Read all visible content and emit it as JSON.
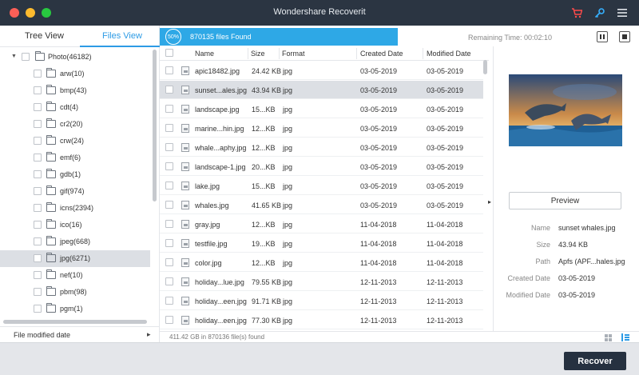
{
  "window": {
    "title": "Wondershare Recoverit"
  },
  "toolbar": {
    "cart_icon": "cart-icon",
    "key_icon": "key-icon",
    "menu_icon": "menu-icon"
  },
  "sidebar": {
    "tabs": [
      {
        "label": "Tree View",
        "active": false
      },
      {
        "label": "Files View",
        "active": true
      }
    ],
    "root": {
      "label": "Photo(46182)"
    },
    "items": [
      {
        "label": "arw(10)"
      },
      {
        "label": "bmp(43)"
      },
      {
        "label": "cdt(4)"
      },
      {
        "label": "cr2(20)"
      },
      {
        "label": "crw(24)"
      },
      {
        "label": "emf(6)"
      },
      {
        "label": "gdb(1)"
      },
      {
        "label": "gif(974)"
      },
      {
        "label": "icns(2394)"
      },
      {
        "label": "ico(16)"
      },
      {
        "label": "jpeg(668)"
      },
      {
        "label": "jpg(6271)",
        "selected": true
      },
      {
        "label": "nef(10)"
      },
      {
        "label": "pbm(98)"
      },
      {
        "label": "pgm(1)"
      }
    ],
    "filter_label": "File modified date"
  },
  "scan": {
    "percent": "50%",
    "percent_value": 50,
    "found_text": "870135 files Found",
    "remaining_time": "Remaining Time: 00:02:10"
  },
  "table": {
    "columns": [
      "Name",
      "Size",
      "Format",
      "Created Date",
      "Modified Date"
    ],
    "rows": [
      {
        "name": "apic18482.jpg",
        "size": "24.42 KB",
        "format": "jpg",
        "created": "03-05-2019",
        "modified": "03-05-2019"
      },
      {
        "name": "sunset...ales.jpg",
        "size": "43.94 KB",
        "format": "jpg",
        "created": "03-05-2019",
        "modified": "03-05-2019",
        "selected": true
      },
      {
        "name": "landscape.jpg",
        "size": "15...KB",
        "format": "jpg",
        "created": "03-05-2019",
        "modified": "03-05-2019"
      },
      {
        "name": "marine...hin.jpg",
        "size": "12...KB",
        "format": "jpg",
        "created": "03-05-2019",
        "modified": "03-05-2019"
      },
      {
        "name": "whale...aphy.jpg",
        "size": "12...KB",
        "format": "jpg",
        "created": "03-05-2019",
        "modified": "03-05-2019"
      },
      {
        "name": "landscape-1.jpg",
        "size": "20...KB",
        "format": "jpg",
        "created": "03-05-2019",
        "modified": "03-05-2019"
      },
      {
        "name": "lake.jpg",
        "size": "15...KB",
        "format": "jpg",
        "created": "03-05-2019",
        "modified": "03-05-2019"
      },
      {
        "name": "whales.jpg",
        "size": "41.65 KB",
        "format": "jpg",
        "created": "03-05-2019",
        "modified": "03-05-2019"
      },
      {
        "name": "gray.jpg",
        "size": "12...KB",
        "format": "jpg",
        "created": "11-04-2018",
        "modified": "11-04-2018"
      },
      {
        "name": "testfile.jpg",
        "size": "19...KB",
        "format": "jpg",
        "created": "11-04-2018",
        "modified": "11-04-2018"
      },
      {
        "name": "color.jpg",
        "size": "12...KB",
        "format": "jpg",
        "created": "11-04-2018",
        "modified": "11-04-2018"
      },
      {
        "name": "holiday...lue.jpg",
        "size": "79.55 KB",
        "format": "jpg",
        "created": "12-11-2013",
        "modified": "12-11-2013"
      },
      {
        "name": "holiday...een.jpg",
        "size": "91.71 KB",
        "format": "jpg",
        "created": "12-11-2013",
        "modified": "12-11-2013"
      },
      {
        "name": "holiday...een.jpg",
        "size": "77.30 KB",
        "format": "jpg",
        "created": "12-11-2013",
        "modified": "12-11-2013"
      }
    ]
  },
  "status": {
    "text": "411.42 GB in 870136 file(s) found"
  },
  "preview": {
    "button_label": "Preview",
    "meta": [
      {
        "key": "Name",
        "value": "sunset whales.jpg"
      },
      {
        "key": "Size",
        "value": "43.94 KB"
      },
      {
        "key": "Path",
        "value": "Apfs (APF...hales.jpg"
      },
      {
        "key": "Created Date",
        "value": "03-05-2019"
      },
      {
        "key": "Modified Date",
        "value": "03-05-2019"
      }
    ]
  },
  "footer": {
    "recover_label": "Recover"
  }
}
